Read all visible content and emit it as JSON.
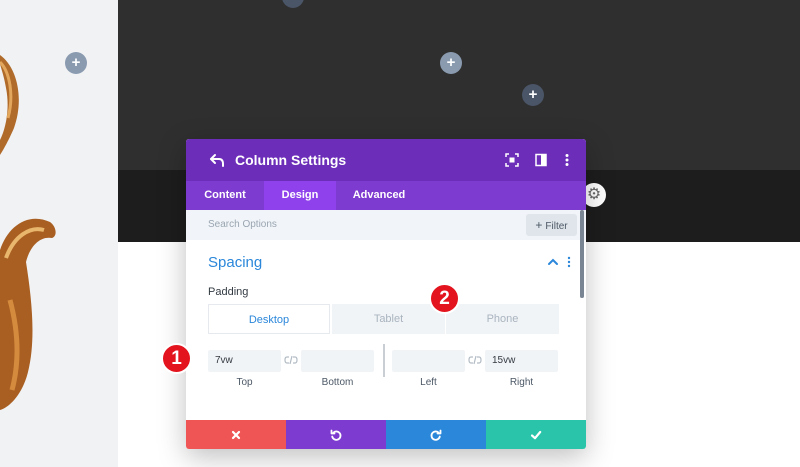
{
  "canvas": {
    "add_buttons": [
      "+",
      "+",
      "+",
      "+"
    ]
  },
  "modal": {
    "title": "Column Settings",
    "header_icons": [
      "back-icon",
      "fullscreen-icon",
      "split-view-icon",
      "more-vertical-icon"
    ],
    "tabs": [
      "Content",
      "Design",
      "Advanced"
    ],
    "active_tab": "Design",
    "search_placeholder": "Search Options",
    "filter_label": "Filter",
    "filter_icon": "+",
    "section": {
      "title": "Spacing",
      "field_label": "Padding",
      "devices": [
        "Desktop",
        "Tablet",
        "Phone"
      ],
      "active_device": "Desktop",
      "fields": {
        "top": {
          "value": "7vw",
          "label": "Top"
        },
        "bottom": {
          "value": "",
          "label": "Bottom"
        },
        "left": {
          "value": "",
          "label": "Left"
        },
        "right": {
          "value": "15vw",
          "label": "Right"
        }
      }
    },
    "footer_icons": [
      "close-icon",
      "undo-icon",
      "redo-icon",
      "check-icon"
    ]
  },
  "annotations": [
    "1",
    "2"
  ],
  "colors": {
    "header": "#6c2eb9",
    "tabs": "#7e3bd0",
    "active_tab": "#8f42ec",
    "accent_blue": "#2b87da",
    "cancel": "#ef5555",
    "undo": "#7e3bd0",
    "redo": "#2b87da",
    "save": "#29c4a9",
    "badge": "#e3141e"
  }
}
